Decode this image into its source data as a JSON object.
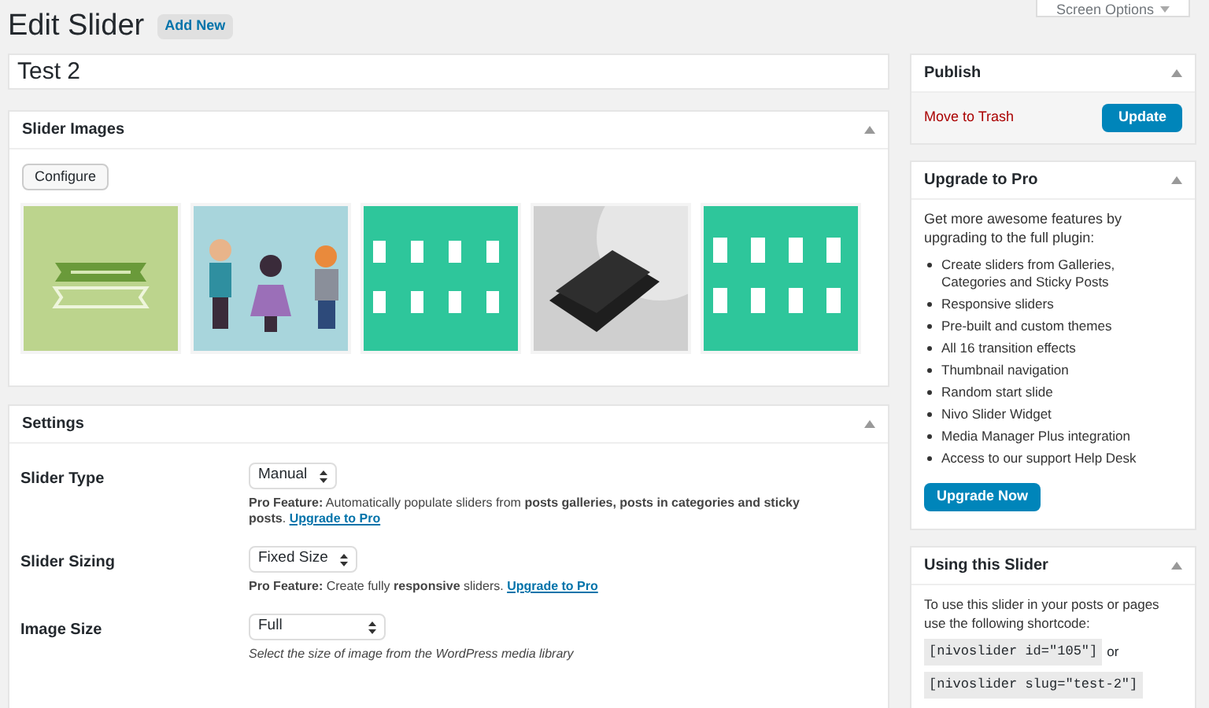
{
  "header": {
    "title": "Edit Slider",
    "add_new": "Add New",
    "screen_options": "Screen Options"
  },
  "title_field": {
    "value": "Test 2"
  },
  "slider_images": {
    "title": "Slider Images",
    "configure": "Configure"
  },
  "settings": {
    "title": "Settings",
    "rows": [
      {
        "label": "Slider Type",
        "value": "Manual",
        "description": "**Pro Feature:** Automatically populate sliders from **posts galleries, posts in categories and sticky posts**.",
        "link": "Upgrade to Pro",
        "italic": false
      },
      {
        "label": "Slider Sizing",
        "value": "Fixed Size",
        "description": "**Pro Feature:** Create fully **responsive** sliders.",
        "link": "Upgrade to Pro",
        "italic": false
      },
      {
        "label": "Image Size",
        "value": "Full",
        "description": "Select the size of image from the WordPress media library",
        "italic": true
      }
    ]
  },
  "publish": {
    "title": "Publish",
    "trash": "Move to Trash",
    "update": "Update"
  },
  "upgrade": {
    "title": "Upgrade to Pro",
    "intro": "Get more awesome features by upgrading to the full plugin:",
    "features": [
      "Create sliders from Galleries, Categories and Sticky Posts",
      "Responsive sliders",
      "Pre-built and custom themes",
      "All 16 transition effects",
      "Thumbnail navigation",
      "Random start slide",
      "Nivo Slider Widget",
      "Media Manager Plus integration",
      "Access to our support Help Desk"
    ],
    "button": "Upgrade Now"
  },
  "using": {
    "title": "Using this Slider",
    "intro": "To use this slider in your posts or pages use the following shortcode:",
    "shortcodes": [
      {
        "code": "[nivoslider id=\"105\"]",
        "suffix": "or"
      },
      {
        "code": "[nivoslider slug=\"test-2\"]"
      }
    ]
  }
}
